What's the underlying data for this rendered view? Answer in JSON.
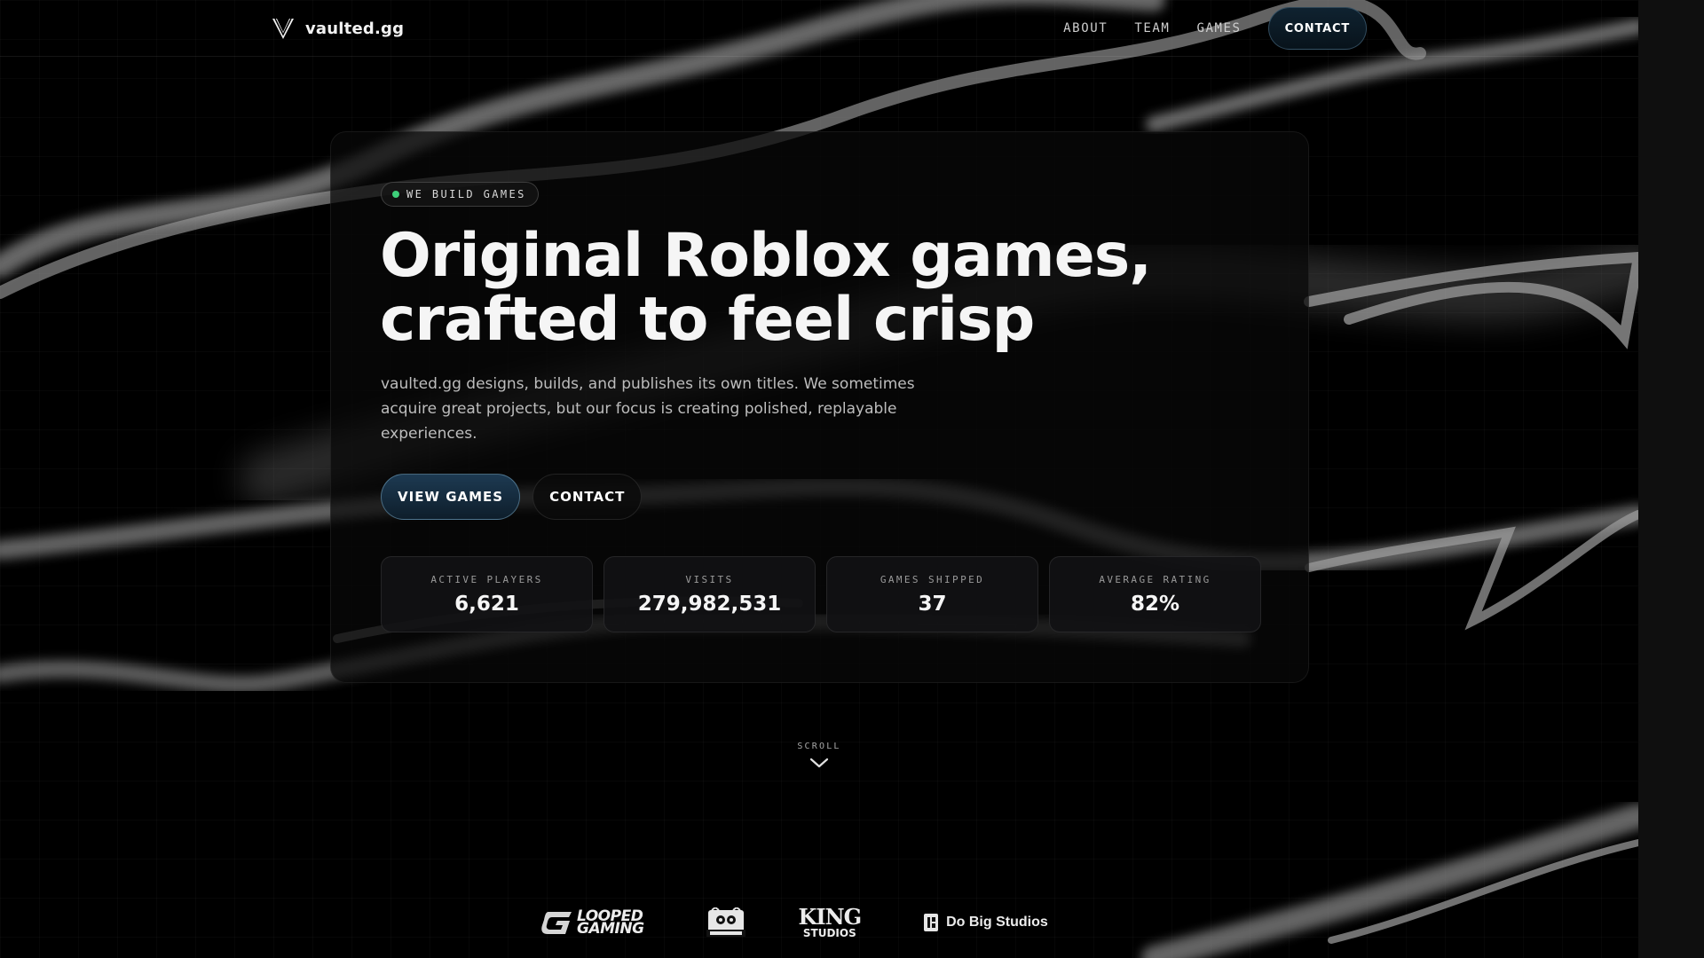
{
  "header": {
    "brand_name": "vaulted.gg",
    "nav": [
      "ABOUT",
      "TEAM",
      "GAMES"
    ],
    "cta_label": "CONTACT"
  },
  "hero": {
    "badge": "WE BUILD GAMES",
    "title_line1": "Original Roblox games,",
    "title_line2": "crafted to feel crisp",
    "description": "vaulted.gg designs, builds, and publishes its own titles. We sometimes acquire great projects, but our focus is creating polished, replayable experiences.",
    "primary_button": "VIEW GAMES",
    "secondary_button": "CONTACT"
  },
  "stats": [
    {
      "label": "ACTIVE PLAYERS",
      "value": "6,621"
    },
    {
      "label": "VISITS",
      "value": "279,982,531"
    },
    {
      "label": "GAMES SHIPPED",
      "value": "37"
    },
    {
      "label": "AVERAGE RATING",
      "value": "82%"
    }
  ],
  "scroll": {
    "label": "SCROLL"
  },
  "partners": {
    "looped_line1": "LOOPED",
    "looped_line2": "GAMING",
    "king_main": "KING",
    "king_sub": "STUDIOS",
    "dobig": "Do Big Studios"
  },
  "colors": {
    "background": "#000000",
    "accent_green": "#3ecf7a",
    "button_blue": "#1d3a52"
  }
}
